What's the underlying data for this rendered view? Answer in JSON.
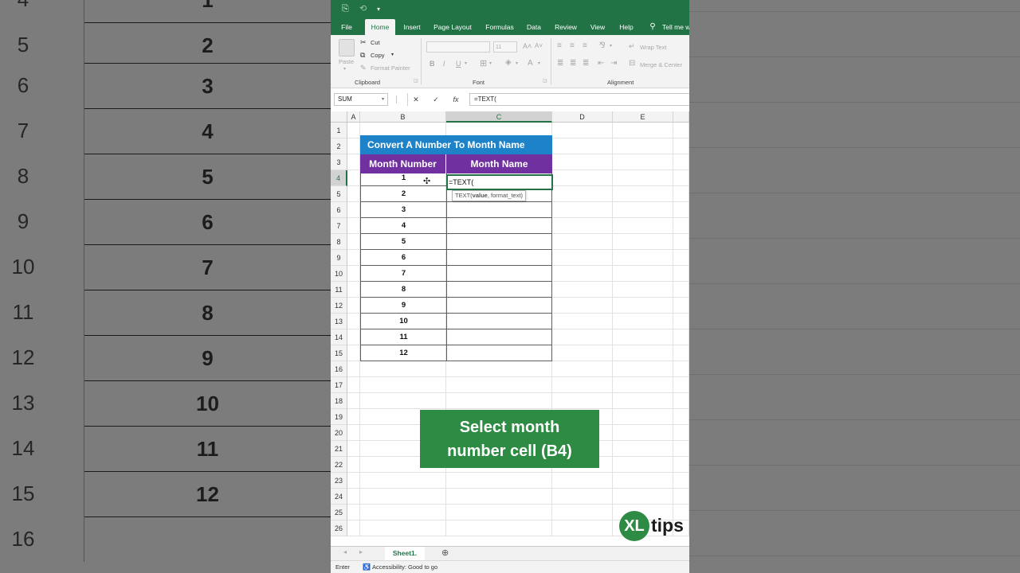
{
  "background_sheet": {
    "rows": [
      {
        "num": "4",
        "value": "1"
      },
      {
        "num": "5",
        "value": "2"
      },
      {
        "num": "6",
        "value": "3"
      },
      {
        "num": "7",
        "value": "4"
      },
      {
        "num": "8",
        "value": "5"
      },
      {
        "num": "9",
        "value": "6"
      },
      {
        "num": "10",
        "value": "7"
      },
      {
        "num": "11",
        "value": "8"
      },
      {
        "num": "12",
        "value": "9"
      },
      {
        "num": "13",
        "value": "10"
      },
      {
        "num": "14",
        "value": "11"
      },
      {
        "num": "15",
        "value": "12"
      },
      {
        "num": "16",
        "value": ""
      }
    ]
  },
  "tabs": [
    "File",
    "Home",
    "Insert",
    "Page Layout",
    "Formulas",
    "Data",
    "Review",
    "View",
    "Help",
    "Tell me w"
  ],
  "active_tab": "Home",
  "ribbon": {
    "clipboard": {
      "paste": "Paste",
      "cut": "Cut",
      "copy": "Copy",
      "format_painter": "Format Painter",
      "label": "Clipboard"
    },
    "font": {
      "size": "11",
      "bold": "B",
      "italic": "I",
      "underline": "U",
      "label": "Font"
    },
    "alignment": {
      "wrap": "Wrap Text",
      "merge": "Merge & Center",
      "label": "Alignment"
    }
  },
  "formula_bar": {
    "name_box": "SUM",
    "cancel": "✕",
    "enter": "✓",
    "fx": "fx",
    "formula": "=TEXT("
  },
  "columns": [
    "A",
    "B",
    "C",
    "D",
    "E"
  ],
  "row_numbers": [
    "1",
    "2",
    "3",
    "4",
    "5",
    "6",
    "7",
    "8",
    "9",
    "10",
    "11",
    "12",
    "13",
    "14",
    "15",
    "16",
    "17",
    "18",
    "19",
    "20",
    "21",
    "22",
    "23",
    "24",
    "25",
    "26"
  ],
  "table": {
    "title": "Convert A Number To Month Name",
    "header_b": "Month Number",
    "header_c": "Month Name",
    "month_numbers": [
      "1",
      "2",
      "3",
      "4",
      "5",
      "6",
      "7",
      "8",
      "9",
      "10",
      "11",
      "12"
    ]
  },
  "active_cell_text": "=TEXT(",
  "tooltip": {
    "prefix": "TEXT(",
    "bold_arg": "value",
    "suffix": ", format_text)"
  },
  "callout": {
    "line1": "Select month",
    "line2": "number cell (B4)"
  },
  "logo": {
    "mark": "XL",
    "word": "tips"
  },
  "sheet_tab": "Sheet1.",
  "status": {
    "mode": "Enter",
    "accessibility": "Accessibility: Good to go"
  },
  "colors": {
    "excel_green": "#217346",
    "title_blue": "#1e82c8",
    "header_purple": "#7030a0",
    "callout_green": "#2e8b44"
  }
}
